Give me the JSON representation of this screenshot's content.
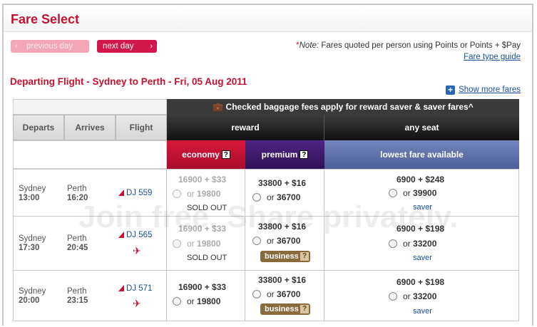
{
  "header": {
    "title": "Fare Select",
    "prev_label": "previous day",
    "next_label": "next day",
    "note_star": "*",
    "note_label": "Note:",
    "note_text": " Fares quoted per person using Points or Points + $Pay",
    "fare_type_guide": "Fare type guide"
  },
  "route": "Departing Flight - Sydney to Perth - Fri, 05 Aug 2011",
  "show_more": "Show more fares",
  "table": {
    "baggage_notice": "Checked baggage fees apply for reward saver & saver fares^",
    "col_departs": "Departs",
    "col_arrives": "Arrives",
    "col_flight": "Flight",
    "group_reward": "reward",
    "group_anyseat": "any seat",
    "sub_economy": "economy",
    "sub_premium": "premium",
    "sub_lowest": "lowest fare available",
    "help_q": "?",
    "colors": {
      "economy": "#c8102e",
      "premium": "#3d1b6b",
      "lowest": "#5d6fa8"
    },
    "rows": [
      {
        "dep_city": "Sydney",
        "dep_time": "13:00",
        "arr_city": "Perth",
        "arr_time": "16:20",
        "flight": "DJ 559",
        "eco_price": "16900 + $33",
        "eco_points": "19800",
        "eco_status": "SOLD OUT",
        "prem_price": "33800 + $16",
        "prem_points": "36700",
        "low_price": "6900 + $248",
        "low_points": "39900",
        "low_type": "saver"
      },
      {
        "dep_city": "Sydney",
        "dep_time": "17:30",
        "arr_city": "Perth",
        "arr_time": "20:45",
        "flight": "DJ 565",
        "eco_price": "16900 + $33",
        "eco_points": "19800",
        "eco_status": "SOLD OUT",
        "prem_price": "33800 + $16",
        "prem_points": "36700",
        "business_label": "business",
        "low_price": "6900 + $198",
        "low_points": "33200",
        "low_type": "saver"
      },
      {
        "dep_city": "Sydney",
        "dep_time": "20:00",
        "arr_city": "Perth",
        "arr_time": "23:15",
        "flight": "DJ 571",
        "eco_price": "16900 + $33",
        "eco_points": "19800",
        "prem_price": "33800 + $16",
        "prem_points": "36700",
        "business_label": "business",
        "low_price": "6900 + $198",
        "low_points": "33200",
        "low_type": "saver"
      }
    ],
    "or_label": "or"
  },
  "watermark": "Join free. Share privately."
}
